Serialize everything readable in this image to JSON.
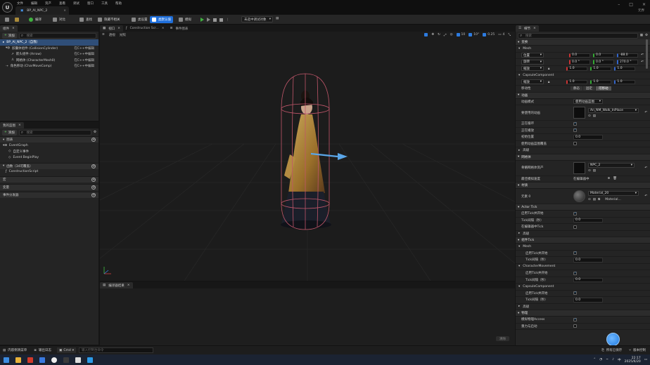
{
  "titlebar": {
    "menus": [
      "文件",
      "编辑",
      "资产",
      "查看",
      "调试",
      "窗口",
      "工具",
      "帮助"
    ],
    "doc_tab": "BP_AI_NPC_2",
    "user": "元界"
  },
  "toolbar": {
    "compile": "编译",
    "diff": "对比",
    "find": "查找",
    "hide_unrelated": "隐藏不相关",
    "class_settings": "类设置",
    "class_defaults": "类默认值",
    "simulate": "模拟",
    "debug_object": "未选中调试对象"
  },
  "components_panel": {
    "tab": "组件",
    "add": "添加",
    "search_placeholder": "搜索",
    "items": [
      {
        "label": "BP_AI_NPC_2（自我）",
        "right": ""
      },
      {
        "label": "胶囊体组件 (CollisionCylinder)",
        "right": "在C++中编辑"
      },
      {
        "label": "箭头组件 (Arrow)",
        "right": "在C++中编辑"
      },
      {
        "label": "网格体 (CharacterMesh0)",
        "right": "在C++中编辑"
      },
      {
        "label": "角色移动 (CharMoveComp)",
        "right": "在C++中编辑"
      }
    ]
  },
  "mybp_panel": {
    "tab": "我的蓝图",
    "add": "添加",
    "search_placeholder": "搜索",
    "graph_section": "图表",
    "graph_items": [
      "EventGraph",
      "自定义事件",
      "Event BeginPlay"
    ],
    "functions_section": "函数（34可覆盖）",
    "function_items": [
      "ConstructionScript"
    ],
    "macros_section": "宏",
    "variables_section": "变量",
    "dispatchers_section": "事件分发器"
  },
  "viewport": {
    "tabs": [
      "视口",
      "Construction Scr...",
      "事件图表"
    ],
    "perspective": "透视",
    "lit": "光照",
    "snap_value": "10",
    "rotate_value": "10°",
    "scale_value": "0.25",
    "camera_speed": "4"
  },
  "compiler_results": {
    "tab": "编译器结果",
    "clear": "清除"
  },
  "details": {
    "tab": "细节",
    "search_placeholder": "搜索",
    "transform": {
      "section": "变换",
      "mesh": "Mesh",
      "location_label": "位置",
      "location": [
        "0.0",
        "0.0",
        "-88.0"
      ],
      "rotation_label": "旋转",
      "rotation": [
        "0.0 °",
        "0.0 °",
        "270.0 °"
      ],
      "scale_label": "缩放",
      "scale": [
        "1.0",
        "1.0",
        "1.0"
      ],
      "capsule": "CapsuleComponent",
      "capsule_scale_label": "缩放",
      "capsule_scale": [
        "1.0",
        "1.0",
        "1.0"
      ],
      "mobility_label": "移动性",
      "mobility_options": [
        "静态",
        "固定",
        "可移动"
      ]
    },
    "animation": {
      "section": "动画",
      "mode_label": "动画模式",
      "mode_value": "使用动画蓝图",
      "anim_class_label": "要使用的动画",
      "anim_class_value": "An_NM_Walk_InPlace",
      "loop_label": "正在循环",
      "playing_label": "正在播放",
      "init_pos_label": "初始位置",
      "init_pos_value": "0.0",
      "anim_from_label": "使用动画蓝图覆盖",
      "advanced": "高级"
    },
    "mesh": {
      "section": "网格体",
      "skeletal_label": "骨骼网格体资产",
      "skeletal_value": "NPC_2",
      "unify_label": "最佳模拟速度",
      "unify_value": "在编辑器中"
    },
    "materials": {
      "section": "材质",
      "element_label": "元素 0",
      "element_value": "Material_20",
      "element_sub": "Material..."
    },
    "actor_tick": {
      "section": "Actor Tick",
      "start_label": "启用Tick并开始",
      "interval_label": "Tick间隔（秒）",
      "interval_value": "0.0",
      "editor_label": "在编辑器中Tick",
      "advanced": "高级"
    },
    "component_tick": {
      "section": "组件Tick",
      "mesh": "Mesh",
      "mesh_start_label": "启用Tick并开始",
      "mesh_interval_label": "Tick间隔（秒）",
      "mesh_interval_value": "0.0",
      "cm": "CharacterMovement",
      "cm_start_label": "启用Tick并开始",
      "cm_interval_label": "Tick间隔（秒）",
      "cm_interval_value": "0.0",
      "cap": "CapsuleComponent",
      "cap_start_label": "启用Tick并开始",
      "cap_interval_label": "Tick间隔（秒）",
      "cap_interval_value": "0.0",
      "advanced": "高级"
    },
    "physics": {
      "section": "物理",
      "simulate_label": "模拟物理Access",
      "mass_label": "重力与启动"
    }
  },
  "statusbar": {
    "content_drawer": "内容侧滑菜单",
    "output_log": "输出日志",
    "cmd": "Cmd",
    "cmd_placeholder": "输入控制台命令",
    "all_saved": "所有已保存",
    "source_control": "版本控制"
  },
  "taskbar": {
    "time": "22:17",
    "date": "2025/6/20",
    "lang": "中"
  }
}
